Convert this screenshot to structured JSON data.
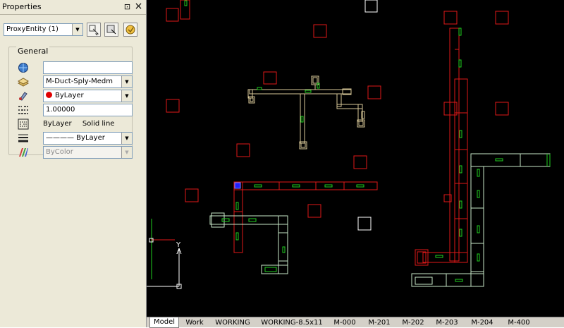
{
  "palette": {
    "title": "Properties",
    "pin_glyph": "⊡",
    "close_glyph": "×",
    "selection": "ProxyEntity (1)",
    "group_title": "General",
    "rows": [
      {
        "icon": "globe-icon",
        "value": ""
      },
      {
        "icon": "layer-icon",
        "value": "M-Duct-Sply-Medm",
        "dropdown": true
      },
      {
        "icon": "color-icon",
        "value": "ByLayer",
        "dropdown": true,
        "swatch": "#e00000"
      },
      {
        "icon": "linetype-scale-icon",
        "value": "1.00000"
      },
      {
        "icon": "linetype-icon",
        "value": "ByLayer",
        "value2": "Solid line"
      },
      {
        "icon": "lineweight-icon",
        "value": "———— ByLayer",
        "dropdown": true
      },
      {
        "icon": "plotstyle-icon",
        "value": "ByColor",
        "dropdown": true,
        "disabled": true
      }
    ]
  },
  "ucs": {
    "y_label": "Y"
  },
  "tabs": [
    "Model",
    "Work",
    "WORKING",
    "WORKING-8.5x11",
    "M-000",
    "M-201",
    "M-202",
    "M-203",
    "M-204",
    "M-400"
  ],
  "active_tab": "Model",
  "colors": {
    "background": "#000000",
    "red": "#e01818",
    "green": "#20d020",
    "tan": "#d8c898",
    "white": "#ffffff",
    "grip": "#2020ff"
  }
}
